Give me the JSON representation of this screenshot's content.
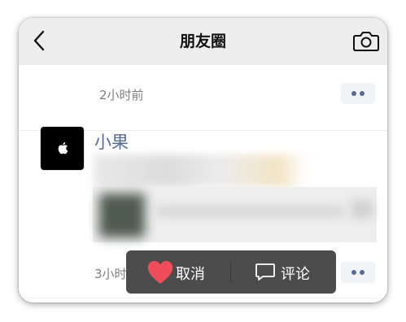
{
  "navbar": {
    "title": "朋友圈",
    "back_icon": "back-chevron-icon",
    "camera_icon": "camera-icon"
  },
  "feed": {
    "posts": [
      {
        "time": "2小时前",
        "more_icon": "more-dots-icon"
      },
      {
        "author": "小果",
        "avatar_icon": "apple-logo-icon",
        "time": "3小时前",
        "more_icon": "more-dots-icon"
      }
    ]
  },
  "action_bar": {
    "like_label": "取消",
    "like_icon": "heart-icon",
    "comment_label": "评论",
    "comment_icon": "comment-bubble-icon"
  },
  "colors": {
    "navbar_bg": "#ededed",
    "link_blue": "#576b95",
    "action_bar_bg": "#4c4c4c",
    "heart_red": "#f04d5b"
  }
}
